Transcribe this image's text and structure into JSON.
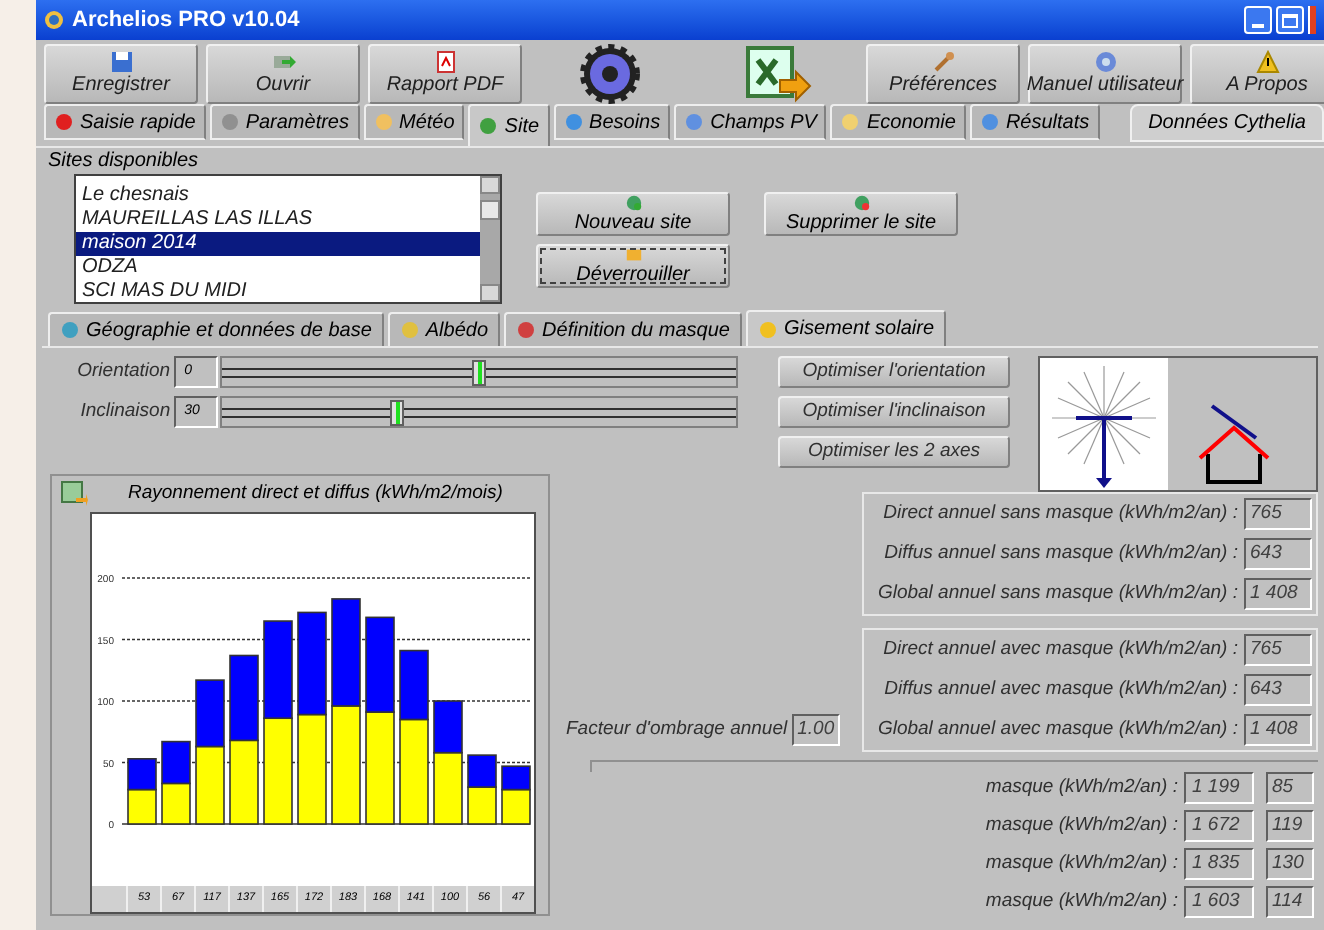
{
  "window": {
    "title": "Archelios PRO v10.04"
  },
  "toolbar": [
    {
      "kind": "save",
      "label": "Enregistrer"
    },
    {
      "kind": "open",
      "label": "Ouvrir"
    },
    {
      "kind": "pdf",
      "label": "Rapport PDF"
    },
    {
      "kind": "gear"
    },
    {
      "kind": "export"
    },
    {
      "kind": "tools",
      "label": "Préférences"
    },
    {
      "kind": "help",
      "label": "Manuel utilisateur"
    },
    {
      "kind": "warning",
      "label": "A Propos"
    }
  ],
  "tabs": [
    {
      "label": "Saisie rapide",
      "selected": false
    },
    {
      "label": "Paramètres",
      "selected": false
    },
    {
      "label": "Météo",
      "selected": false
    },
    {
      "label": "Site",
      "selected": true
    },
    {
      "label": "Besoins",
      "selected": false
    },
    {
      "label": "Champs PV",
      "selected": false
    },
    {
      "label": "Economie",
      "selected": false
    },
    {
      "label": "Résultats",
      "selected": false
    }
  ],
  "data_source": "Données Cythelia",
  "sites": {
    "label": "Sites disponibles",
    "items": [
      {
        "label": "Le chesnais",
        "selected": false
      },
      {
        "label": "MAUREILLAS LAS ILLAS",
        "selected": false
      },
      {
        "label": "maison 2014",
        "selected": true
      },
      {
        "label": "ODZA",
        "selected": false
      },
      {
        "label": "SCI MAS DU MIDI",
        "selected": false
      }
    ]
  },
  "site_buttons": [
    "Nouveau site",
    "Supprimer le site",
    "Déverrouiller"
  ],
  "subtabs": [
    {
      "label": "Géographie et données de base",
      "selected": false
    },
    {
      "label": "Albédo",
      "selected": false
    },
    {
      "label": "Définition du masque",
      "selected": false
    },
    {
      "label": "Gisement solaire",
      "selected": true
    }
  ],
  "sliders": [
    {
      "label": "Orientation",
      "value": "0",
      "level": 0.5
    },
    {
      "label": "Inclinaison",
      "value": "30",
      "level": 0.34
    }
  ],
  "optimize_buttons": [
    "Optimiser l'orientation",
    "Optimiser l'inclinaison",
    "Optimiser les 2 axes"
  ],
  "chart": {
    "chart_data": {
      "type": "bar",
      "stacked": true,
      "title": "Rayonnement direct et diffus (kWh/m2/mois)",
      "categories": [
        "53",
        "67",
        "117",
        "137",
        "165",
        "172",
        "183",
        "168",
        "141",
        "100",
        "56",
        "47"
      ],
      "series": [
        {
          "color": "#ffff00",
          "values": [
            28,
            33,
            63,
            68,
            86,
            89,
            96,
            91,
            85,
            58,
            30,
            28
          ]
        },
        {
          "color": "#0000ff",
          "values": [
            25,
            34,
            54,
            69,
            79,
            83,
            87,
            77,
            56,
            42,
            26,
            19
          ]
        }
      ],
      "ylim": [
        0,
        200
      ],
      "grid": true,
      "yticks": [
        0,
        50,
        100,
        150,
        200
      ]
    }
  },
  "annual_without_mask": [
    {
      "label": "Direct annuel sans masque (kWh/m2/an) :",
      "value": "765"
    },
    {
      "label": "Diffus annuel sans masque (kWh/m2/an) :",
      "value": "643"
    },
    {
      "label": "Global annuel sans masque (kWh/m2/an) :",
      "value": "1 408"
    }
  ],
  "annual_with_mask": [
    {
      "label": "Direct annuel avec masque (kWh/m2/an) :",
      "value": "765"
    },
    {
      "label": "Diffus annuel avec masque (kWh/m2/an) :",
      "value": "643"
    },
    {
      "label": "Global annuel avec masque (kWh/m2/an) :",
      "value": "1 408"
    }
  ],
  "shading_factor": {
    "label": "Facteur d'ombrage annuel",
    "value": "1.00"
  },
  "mask_rows": [
    {
      "label": "masque (kWh/m2/an) :",
      "value": "1 199",
      "percent": "85"
    },
    {
      "label": "masque (kWh/m2/an) :",
      "value": "1 672",
      "percent": "119"
    },
    {
      "label": "masque (kWh/m2/an) :",
      "value": "1 835",
      "percent": "130"
    },
    {
      "label": "masque (kWh/m2/an) :",
      "value": "1 603",
      "percent": "114"
    }
  ]
}
